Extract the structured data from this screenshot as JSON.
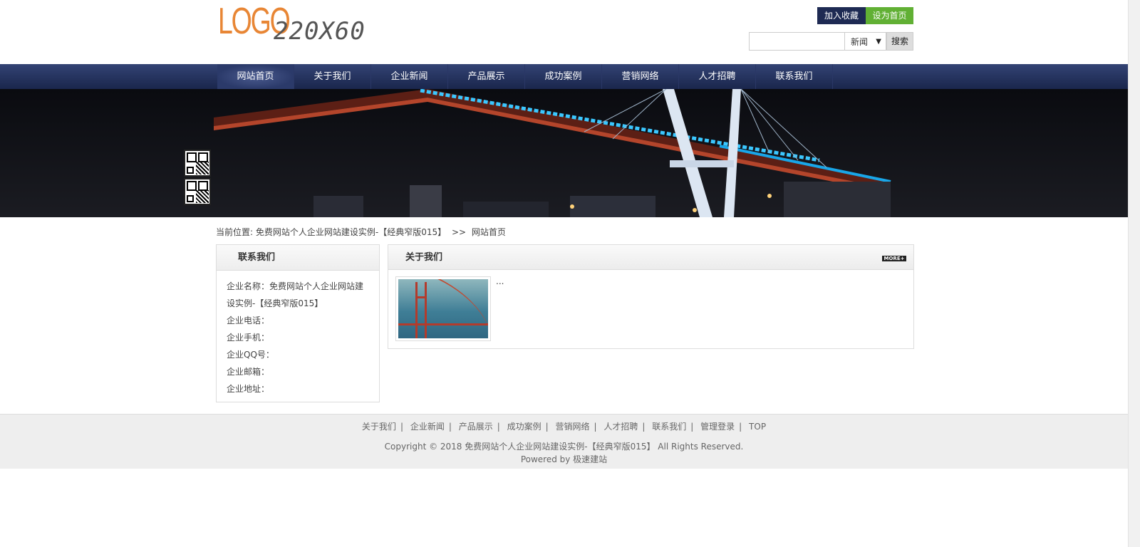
{
  "header": {
    "logo_main": "LOGO",
    "logo_sub": "220X60",
    "favorite_label": "加入收藏",
    "homepage_label": "设为首页",
    "search": {
      "placeholder": "",
      "select_value": "新闻",
      "button_label": "搜索"
    }
  },
  "nav": {
    "items": [
      {
        "label": "网站首页",
        "active": true
      },
      {
        "label": "关于我们",
        "active": false
      },
      {
        "label": "企业新闻",
        "active": false
      },
      {
        "label": "产品展示",
        "active": false
      },
      {
        "label": "成功案例",
        "active": false
      },
      {
        "label": "营销网络",
        "active": false
      },
      {
        "label": "人才招聘",
        "active": false
      },
      {
        "label": "联系我们",
        "active": false
      }
    ]
  },
  "breadcrumb": {
    "prefix": "当前位置:",
    "site": "免费网站个人企业网站建设实例-【经典窄版015】",
    "separator": ">>",
    "current": "网站首页"
  },
  "contact": {
    "title": "联系我们",
    "lines": [
      "企业名称：免费网站个人企业网站建设实例-【经典窄版015】",
      "企业电话：",
      "企业手机：",
      "企业QQ号：",
      "企业邮箱：",
      "企业地址："
    ]
  },
  "about": {
    "title": "关于我们",
    "more_label": "MORE+",
    "excerpt": "..."
  },
  "footer": {
    "links": [
      "关于我们",
      "企业新闻",
      "产品展示",
      "成功案例",
      "营销网络",
      "人才招聘",
      "联系我们",
      "管理登录",
      "TOP"
    ],
    "separator": "|",
    "copyright": "Copyright © 2018 免费网站个人企业网站建设实例-【经典窄版015】 All Rights Reserved.",
    "powered": "Powered by 极速建站"
  },
  "colors": {
    "accent_nav": "#1e2a53",
    "accent_green": "#61b034",
    "logo_orange": "#e88635"
  }
}
